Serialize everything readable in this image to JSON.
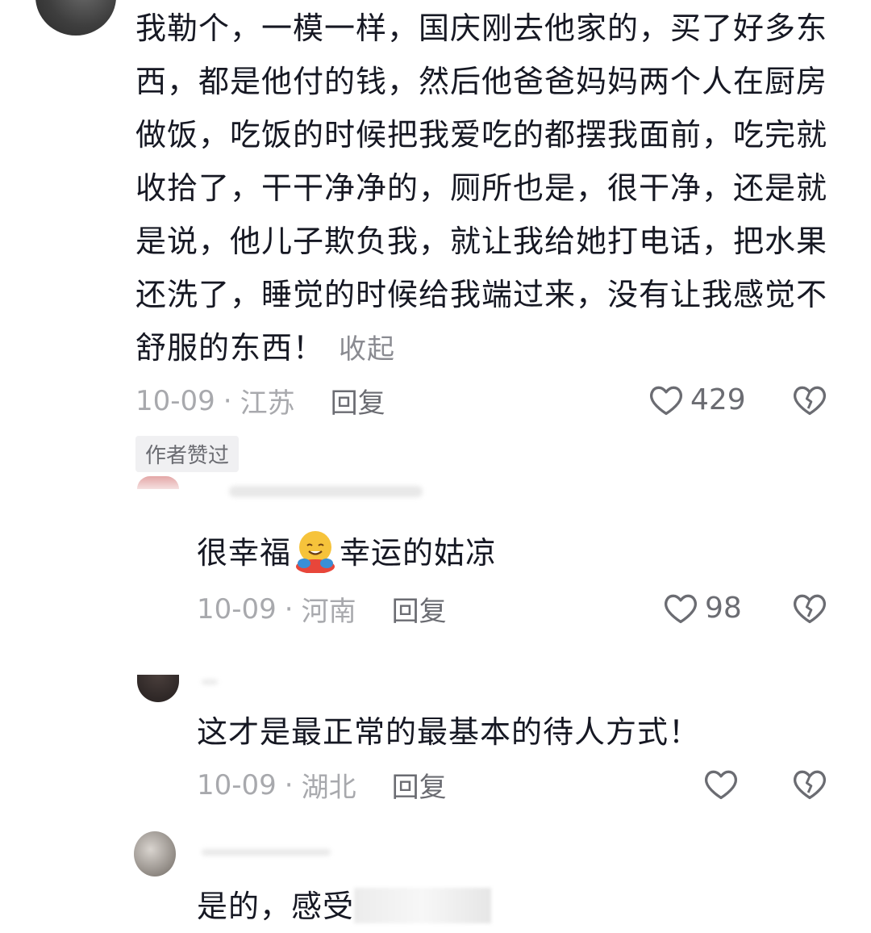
{
  "comments": [
    {
      "text": "我勒个，一模一样，国庆刚去他家的，买了好多东西，都是他付的钱，然后他爸爸妈妈两个人在厨房做饭，吃饭的时候把我爱吃的都摆我面前，吃完就收拾了，干干净净的，厕所也是，很干净，还是就是说，他儿子欺负我，就让我给她打电话，把水果还洗了，睡觉的时候给我端过来，没有让我感觉不舒服的东西！",
      "collapse_label": "收起",
      "date": "10-09",
      "region": "江苏",
      "reply_label": "回复",
      "likes": "429",
      "badge": "作者赞过"
    },
    {
      "text_before": "很幸福",
      "emoji": "hugging-face-emoji",
      "text_after": "幸运的姑凉",
      "date": "10-09",
      "region": "河南",
      "reply_label": "回复",
      "likes": "98"
    },
    {
      "text": "这才是最正常的最基本的待人方式！",
      "date": "10-09",
      "region": "湖北",
      "reply_label": "回复",
      "likes": ""
    },
    {
      "text": "是的，感受"
    }
  ],
  "separator": "·",
  "icons": {
    "like": "heart-outline-icon",
    "dislike": "broken-heart-icon"
  },
  "colors": {
    "text": "#161823",
    "meta": "#a8a9ad",
    "action": "#6b6c72"
  }
}
